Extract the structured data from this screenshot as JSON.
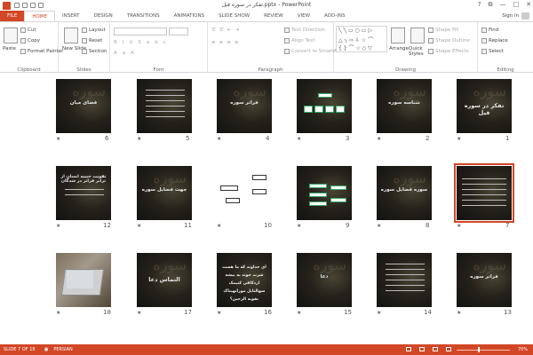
{
  "window": {
    "title": "تفکر در سوره فیل.pptx - PowerPoint",
    "controls": [
      "?",
      "⧉",
      "—",
      "□",
      "✕"
    ]
  },
  "tabs": [
    "FILE",
    "HOME",
    "INSERT",
    "DESIGN",
    "TRANSITIONS",
    "ANIMATIONS",
    "SLIDE SHOW",
    "REVIEW",
    "VIEW",
    "ADD-INS"
  ],
  "active_tab": "HOME",
  "account": {
    "sign_in": "Sign in"
  },
  "ribbon": {
    "clipboard": {
      "label": "Clipboard",
      "paste": "Paste",
      "cut": "Cut",
      "copy": "Copy",
      "format_painter": "Format Painter"
    },
    "slides": {
      "label": "Slides",
      "new_slide": "New Slide",
      "layout": "Layout",
      "reset": "Reset",
      "section": "Section"
    },
    "font": {
      "label": "Font"
    },
    "paragraph": {
      "label": "Paragraph",
      "text_direction": "Text Direction",
      "align_text": "Align Text",
      "convert_smartart": "Convert to SmartArt"
    },
    "drawing": {
      "label": "Drawing",
      "arrange": "Arrange",
      "quick_styles": "Quick Styles",
      "shape_fill": "Shape Fill",
      "shape_outline": "Shape Outline",
      "shape_effects": "Shape Effects"
    },
    "editing": {
      "label": "Editing",
      "find": "Find",
      "replace": "Replace",
      "select": "Select"
    }
  },
  "slides": [
    {
      "number": "1",
      "title": "تفکر در سوره فیل"
    },
    {
      "number": "2",
      "title": "شناسه سوره"
    },
    {
      "number": "3",
      "title": ""
    },
    {
      "number": "4",
      "title": "فراتر سوره"
    },
    {
      "number": "5",
      "title": ""
    },
    {
      "number": "6",
      "title": "فضای میان"
    },
    {
      "number": "7",
      "title": ""
    },
    {
      "number": "8",
      "title": "سوره فضایل سوره"
    },
    {
      "number": "9",
      "title": ""
    },
    {
      "number": "10",
      "title": ""
    },
    {
      "number": "11",
      "title": "جهت فضایل سوره"
    },
    {
      "number": "12",
      "title": "تقویت حبیبه انسان از تراتر فراتر در شدگان"
    },
    {
      "number": "13",
      "title": "فراتر سوره"
    },
    {
      "number": "14",
      "title": ""
    },
    {
      "number": "15",
      "title": "دعا"
    },
    {
      "number": "16",
      "title": "اي خداوند که ما هست شرت خوند به بيشه ازدکافي کنيمک سهالتابل موراتهيناک نقوبه الرحين؟"
    },
    {
      "number": "17",
      "title": "التماس دعا"
    },
    {
      "number": "18",
      "title": ""
    }
  ],
  "status": {
    "slide_of": "SLIDE 7 OF 18",
    "language": "PERSIAN",
    "zoom": "70%"
  },
  "colors": {
    "accent": "#d24726"
  }
}
